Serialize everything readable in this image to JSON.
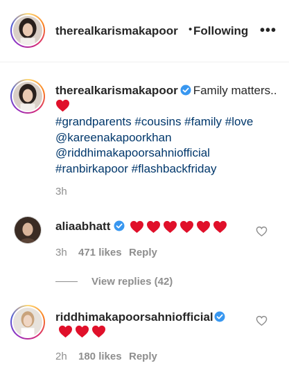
{
  "header": {
    "username": "therealkarismakapoor",
    "separator": "•",
    "following_label": "Following",
    "more_label": "•••"
  },
  "post": {
    "username": "therealkarismakapoor",
    "text": "Family matters..",
    "tags": [
      "#grandparents #cousins #family #love",
      "@kareenakapoorkhan",
      "@riddhimakapoorsahniofficial",
      "#ranbirkapoor #flashbackfriday"
    ],
    "time": "3h"
  },
  "comments": [
    {
      "username": "aliaabhatt",
      "heart_count": 6,
      "time": "3h",
      "likes": "471 likes",
      "reply_label": "Reply",
      "view_replies": "View replies (42)"
    },
    {
      "username": "riddhimakapoorsahniofficial",
      "heart_count": 3,
      "time": "2h",
      "likes": "180 likes",
      "reply_label": "Reply"
    }
  ],
  "colors": {
    "text": "#262626",
    "secondary": "#8e8e8e",
    "link": "#00376b",
    "verified": "#3897f0",
    "heart": "#e0102a"
  },
  "icons": {
    "verified": "verified-badge-icon",
    "heart": "red-heart-emoji",
    "like": "heart-outline-icon",
    "more": "more-options-icon"
  }
}
